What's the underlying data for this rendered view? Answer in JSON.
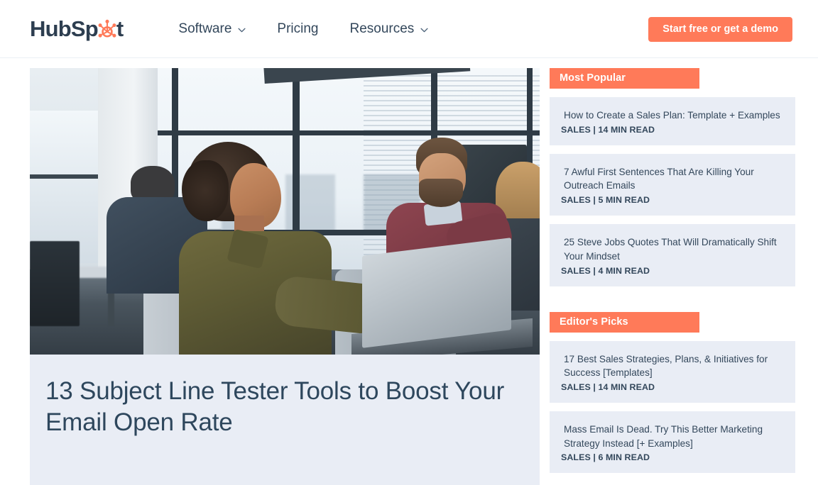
{
  "header": {
    "logo": {
      "text_before": "HubSp",
      "icon": "hubspot-sprocket-icon",
      "text_after": "t"
    },
    "nav": [
      {
        "label": "Software",
        "has_caret": true
      },
      {
        "label": "Pricing",
        "has_caret": false
      },
      {
        "label": "Resources",
        "has_caret": true
      }
    ],
    "cta_label": "Start free or get a demo"
  },
  "article": {
    "hero_alt": "Woman in olive shirt typing on a laptop in a bright open-plan office",
    "headline": "13 Subject Line Tester Tools to Boost Your Email Open Rate"
  },
  "sidebar": {
    "sections": [
      {
        "heading": "Most Popular",
        "items": [
          {
            "title": "How to Create a Sales Plan: Template + Examples",
            "meta": "SALES | 14 MIN READ"
          },
          {
            "title": "7 Awful First Sentences That Are Killing Your Outreach Emails",
            "meta": "SALES | 5 MIN READ"
          },
          {
            "title": "25 Steve Jobs Quotes That Will Dramatically Shift Your Mindset",
            "meta": "SALES | 4 MIN READ"
          }
        ]
      },
      {
        "heading": "Editor's Picks",
        "items": [
          {
            "title": "17 Best Sales Strategies, Plans, & Initiatives for Success [Templates]",
            "meta": "SALES | 14 MIN READ"
          },
          {
            "title": "Mass Email Is Dead. Try This Better Marketing Strategy Instead [+ Examples]",
            "meta": "SALES | 6 MIN READ"
          }
        ]
      }
    ]
  },
  "colors": {
    "brand_orange": "#ff7a59",
    "text_navy": "#33475b",
    "headline_navy": "#2e475d",
    "card_bg": "#e9edf5",
    "page_bg": "#ffffff"
  }
}
